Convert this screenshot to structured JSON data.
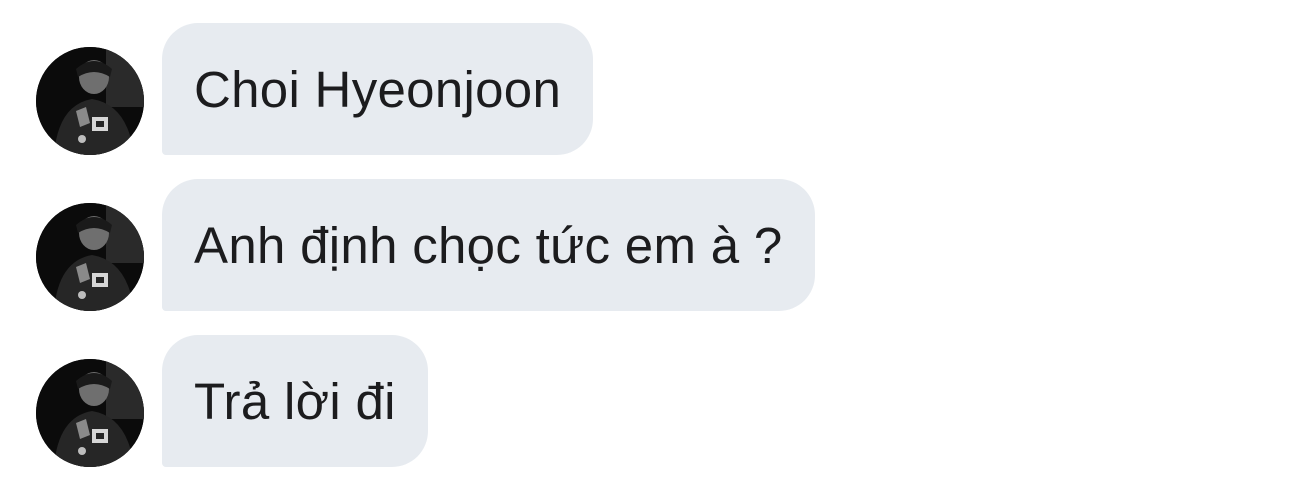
{
  "chat": {
    "messages": [
      {
        "sender_avatar_icon": "profile-photo-avatar",
        "text": "Choi Hyeonjoon"
      },
      {
        "sender_avatar_icon": "profile-photo-avatar",
        "text": "Anh định chọc tức em à ?"
      },
      {
        "sender_avatar_icon": "profile-photo-avatar",
        "text": "Trả lời đi"
      }
    ]
  },
  "colors": {
    "page_background": "#ffffff",
    "bubble_background": "#e7ebf0",
    "text": "#1c1c1e",
    "avatar_background": "#0b0b0b"
  }
}
